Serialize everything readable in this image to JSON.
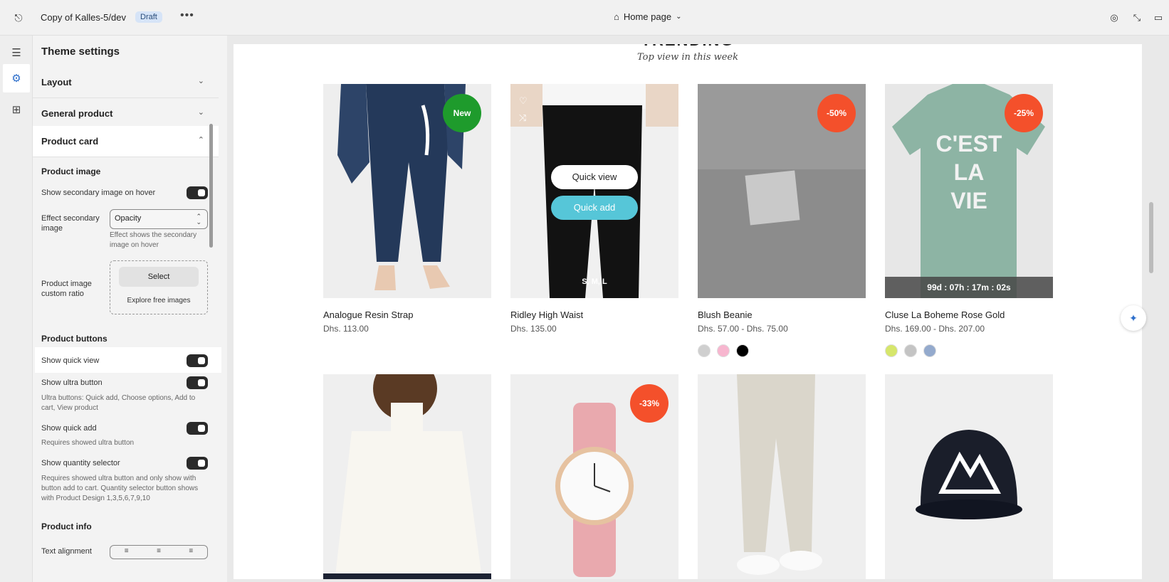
{
  "topbar": {
    "store_name": "Copy of Kalles-5/dev",
    "status_badge": "Draft",
    "more_label": "•••",
    "page_selector": "Home page"
  },
  "sidebar": {
    "title": "Theme settings",
    "accordions": [
      {
        "label": "Layout"
      },
      {
        "label": "General product"
      },
      {
        "label": "Product card"
      }
    ],
    "product_image": {
      "heading": "Product image",
      "show_secondary": "Show secondary image on hover",
      "effect_label": "Effect secondary image",
      "effect_value": "Opacity",
      "effect_hint": "Effect shows the secondary image on hover",
      "ratio_label": "Product image custom ratio",
      "select_button": "Select",
      "explore_link": "Explore free images"
    },
    "product_buttons": {
      "heading": "Product buttons",
      "show_quick_view": "Show quick view",
      "show_ultra_button": "Show ultra button",
      "ultra_hint": "Ultra buttons: Quick add, Choose options, Add to cart, View product",
      "show_quick_add": "Show quick add",
      "quick_add_hint": "Requires showed ultra button",
      "show_quantity": "Show quantity selector",
      "quantity_hint": "Requires showed ultra button and only show with button add to cart. Quantity selector button shows with Product Design 1,3,5,6,7,9,10"
    },
    "product_info": {
      "heading": "Product info",
      "text_alignment": "Text alignment"
    }
  },
  "preview": {
    "heading": "TRENDING",
    "subtitle": "Top view in this week",
    "products": [
      {
        "name": "Analogue Resin Strap",
        "price": "Dhs. 113.00",
        "badge": "New"
      },
      {
        "name": "Ridley High Waist",
        "price": "Dhs. 135.00",
        "quick_view": "Quick view",
        "quick_add": "Quick add",
        "sizes": "S, M, L"
      },
      {
        "name": "Blush Beanie",
        "price": "Dhs. 57.00 - Dhs. 75.00",
        "badge": "-50%"
      },
      {
        "name": "Cluse La Boheme Rose Gold",
        "price": "Dhs. 169.00 - Dhs. 207.00",
        "badge": "-25%",
        "countdown": "99d : 07h : 17m : 02s"
      },
      {
        "badge": "-33%"
      }
    ],
    "swatches_beanie": [
      "#cfcfcf",
      "#f7b6cf",
      "#000000"
    ],
    "swatches_cluse": [
      "#d6e66b",
      "#c4c4c4",
      "#94aacd"
    ]
  }
}
